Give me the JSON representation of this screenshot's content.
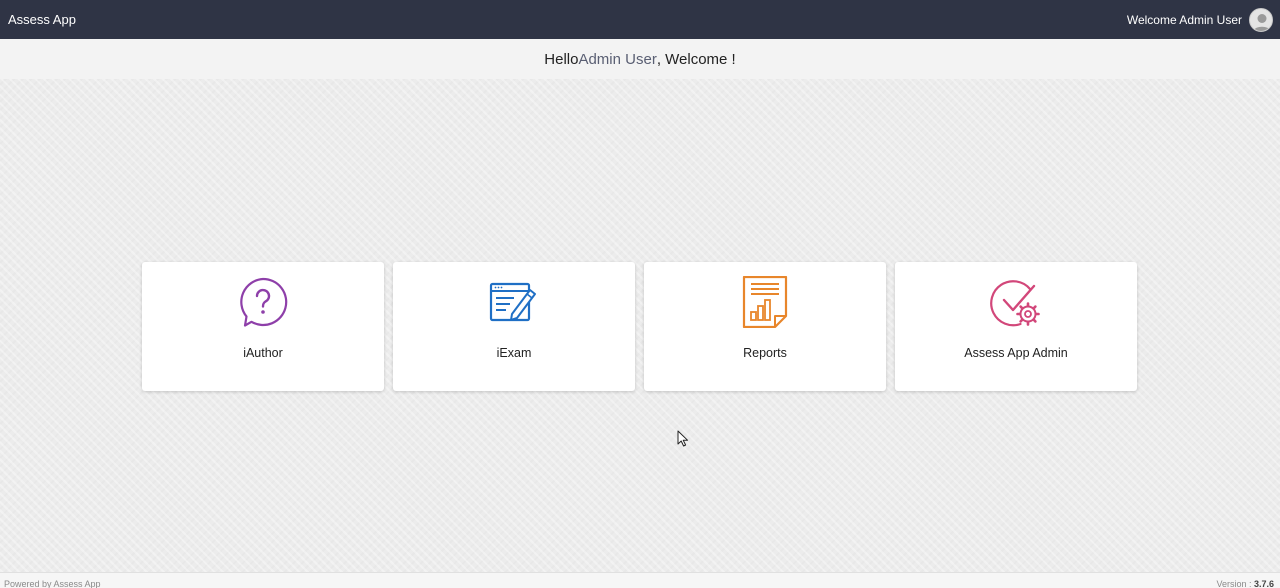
{
  "header": {
    "brand": "Assess App",
    "welcome_text": "Welcome Admin User"
  },
  "greeting": {
    "prefix": "Hello ",
    "name": "Admin User",
    "suffix": ", Welcome !"
  },
  "tiles": [
    {
      "label": "iAuthor",
      "icon": "question-bubble-icon",
      "color": "#8e3fa9"
    },
    {
      "label": "iExam",
      "icon": "exam-edit-icon",
      "color": "#1f6fc5"
    },
    {
      "label": "Reports",
      "icon": "report-document-icon",
      "color": "#e8862b"
    },
    {
      "label": "Assess App Admin",
      "icon": "admin-settings-icon",
      "color": "#d2477a"
    }
  ],
  "footer": {
    "powered_by": "Powered by Assess App",
    "version_label": "Version : ",
    "version_number": "3.7.6"
  }
}
